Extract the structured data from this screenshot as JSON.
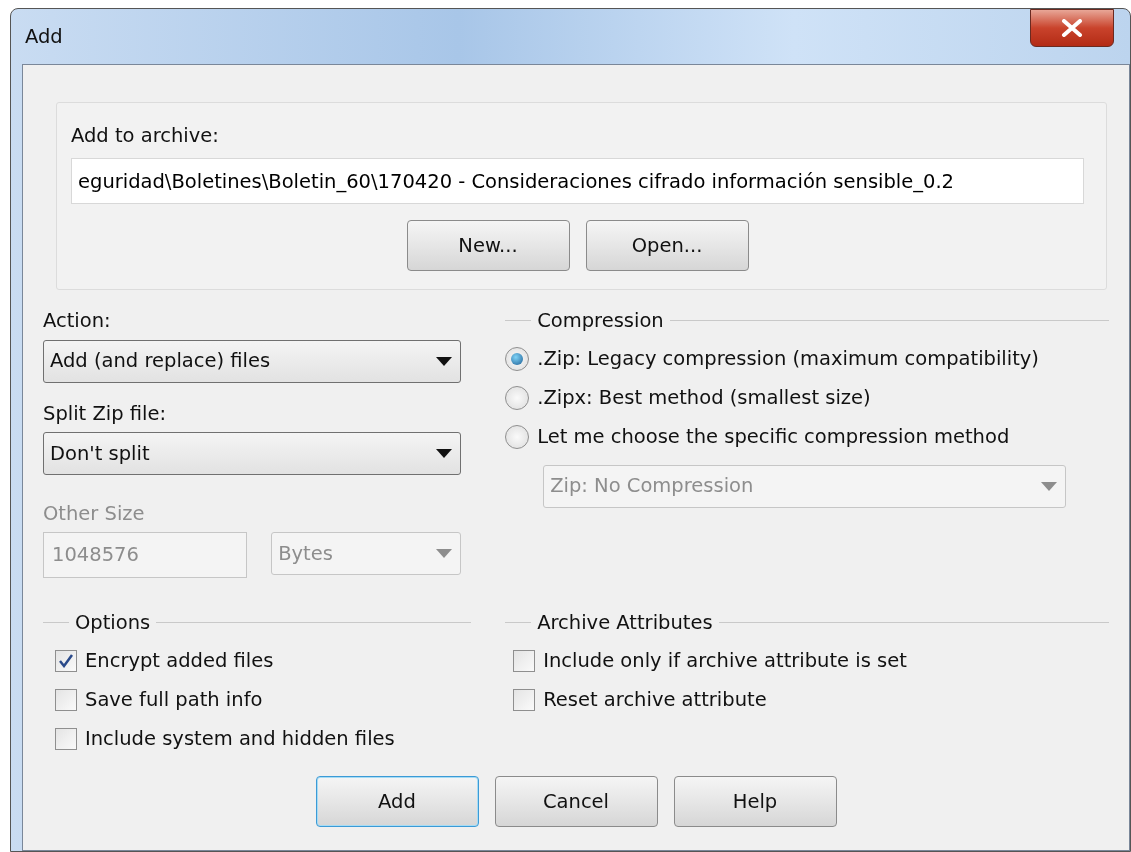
{
  "window": {
    "title": "Add"
  },
  "archive": {
    "label": "Add to archive:",
    "value": "eguridad\\Boletines\\Boletin_60\\170420 - Consideraciones cifrado información sensible_0.2",
    "buttons": [
      "New...",
      "Open..."
    ]
  },
  "action": {
    "label": "Action:",
    "value": "Add (and replace) files"
  },
  "split": {
    "label": "Split Zip file:",
    "value": "Don't split"
  },
  "other_size": {
    "label": "Other Size",
    "value": "1048576",
    "unit": "Bytes",
    "disabled": true
  },
  "compression": {
    "title": "Compression",
    "options": [
      {
        "label": ".Zip: Legacy compression (maximum compatibility)",
        "selected": true
      },
      {
        "label": ".Zipx: Best method (smallest size)",
        "selected": false
      },
      {
        "label": "Let me choose the specific compression method",
        "selected": false
      }
    ],
    "method": {
      "value": "Zip: No Compression",
      "disabled": true
    }
  },
  "options": {
    "title": "Options",
    "items": [
      {
        "label": "Encrypt added files",
        "checked": true
      },
      {
        "label": "Save full path info",
        "checked": false
      },
      {
        "label": "Include system and hidden files",
        "checked": false
      }
    ]
  },
  "archive_attributes": {
    "title": "Archive Attributes",
    "items": [
      {
        "label": "Include only if archive attribute is set",
        "checked": false
      },
      {
        "label": "Reset archive attribute",
        "checked": false
      }
    ]
  },
  "buttons": [
    {
      "label": "Add",
      "default": true
    },
    {
      "label": "Cancel",
      "default": false
    },
    {
      "label": "Help",
      "default": false
    }
  ]
}
